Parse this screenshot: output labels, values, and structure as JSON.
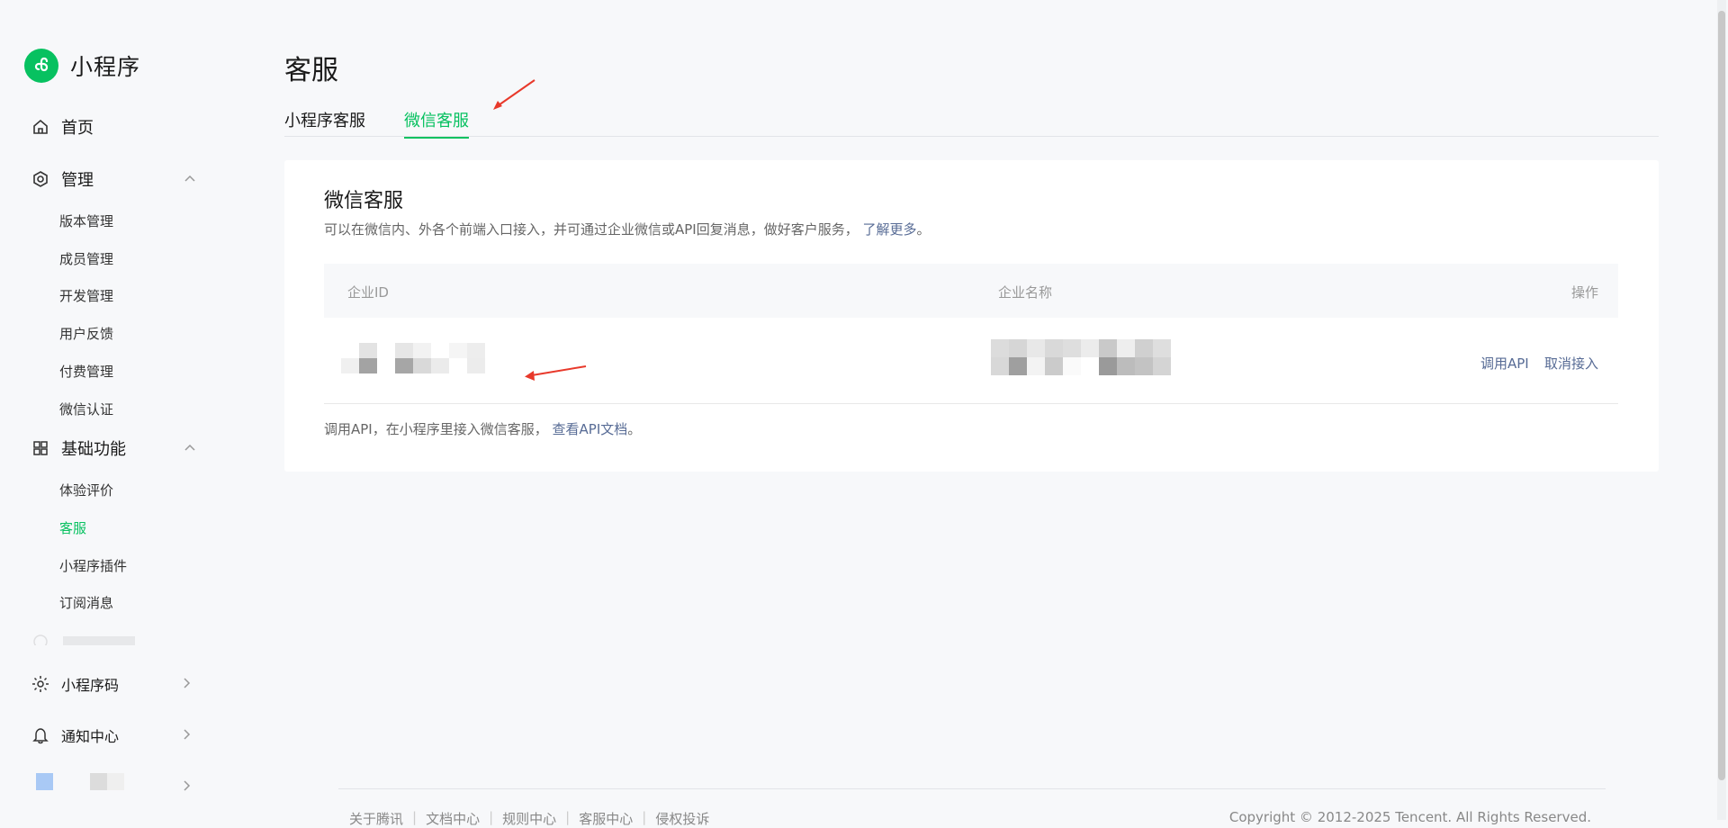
{
  "app": {
    "title": "小程序"
  },
  "sidebar": {
    "home": "首页",
    "manage": {
      "label": "管理",
      "items": [
        "版本管理",
        "成员管理",
        "开发管理",
        "用户反馈",
        "付费管理",
        "微信认证"
      ]
    },
    "basic": {
      "label": "基础功能",
      "items": [
        "体验评价",
        "客服",
        "小程序插件",
        "订阅消息"
      ]
    },
    "bottom": {
      "qrcode": "小程序码",
      "notify": "通知中心"
    }
  },
  "page": {
    "title": "客服"
  },
  "tabs": [
    {
      "label": "小程序客服",
      "active": false
    },
    {
      "label": "微信客服",
      "active": true
    }
  ],
  "card": {
    "title": "微信客服",
    "desc": "可以在微信内、外各个前端入口接入，并可通过企业微信或API回复消息，做好客户服务，",
    "desc_link": "了解更多",
    "desc_end": "。",
    "columns": [
      "企业ID",
      "企业名称",
      "操作"
    ],
    "row_actions": [
      "调用API",
      "取消接入"
    ],
    "foot": "调用API，在小程序里接入微信客服，",
    "foot_link": "查看API文档",
    "foot_end": "。"
  },
  "footer": {
    "links": [
      "关于腾讯",
      "文档中心",
      "规则中心",
      "客服中心",
      "侵权投诉"
    ],
    "copyright": "Copyright © 2012-2025 Tencent. All Rights Reserved."
  },
  "colors": {
    "accent": "#07c160",
    "link": "#576b95",
    "annotation": "#e8392b"
  }
}
